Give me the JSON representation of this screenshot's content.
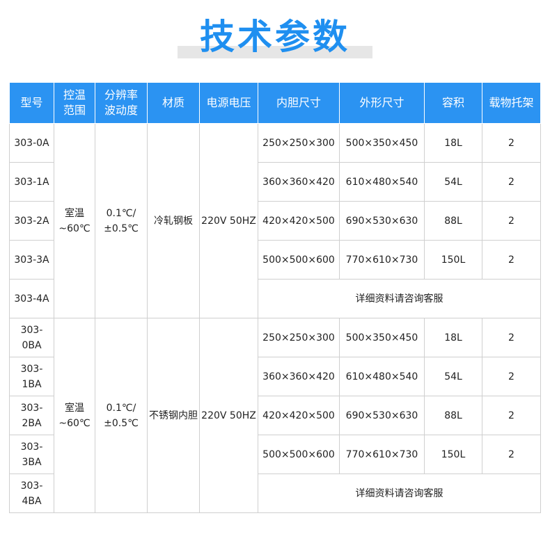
{
  "title": "技术参数",
  "columns": [
    "型号",
    "控温范围",
    "分辨率波动度",
    "材质",
    "电源电压",
    "内胆尺寸",
    "外形尺寸",
    "容积",
    "载物托架"
  ],
  "groups": [
    {
      "control_range": [
        "室温",
        "~60℃"
      ],
      "resolution": [
        "0.1℃/",
        "±0.5℃"
      ],
      "material": "冷轧钢板",
      "voltage": "220V 50HZ",
      "rows": [
        {
          "model": "303-0A",
          "inner": "250×250×300",
          "outer": "500×350×450",
          "volume": "18L",
          "shelves": "2"
        },
        {
          "model": "303-1A",
          "inner": "360×360×420",
          "outer": "610×480×540",
          "volume": "54L",
          "shelves": "2"
        },
        {
          "model": "303-2A",
          "inner": "420×420×500",
          "outer": "690×530×630",
          "volume": "88L",
          "shelves": "2"
        },
        {
          "model": "303-3A",
          "inner": "500×500×600",
          "outer": "770×610×730",
          "volume": "150L",
          "shelves": "2"
        }
      ],
      "last_model": "303-4A",
      "note": "详细资料请咨询客服"
    },
    {
      "control_range": [
        "室温",
        "~60℃"
      ],
      "resolution": [
        "0.1℃/",
        "±0.5℃"
      ],
      "material": "不锈钢内胆",
      "voltage": "220V 50HZ",
      "rows": [
        {
          "model": "303-0BA",
          "inner": "250×250×300",
          "outer": "500×350×450",
          "volume": "18L",
          "shelves": "2"
        },
        {
          "model": "303-1BA",
          "inner": "360×360×420",
          "outer": "610×480×540",
          "volume": "54L",
          "shelves": "2"
        },
        {
          "model": "303-2BA",
          "inner": "420×420×500",
          "outer": "690×530×630",
          "volume": "88L",
          "shelves": "2"
        },
        {
          "model": "303-3BA",
          "inner": "500×500×600",
          "outer": "770×610×730",
          "volume": "150L",
          "shelves": "2"
        }
      ],
      "last_model": "303-4BA",
      "note": "详细资料请咨询客服"
    }
  ]
}
